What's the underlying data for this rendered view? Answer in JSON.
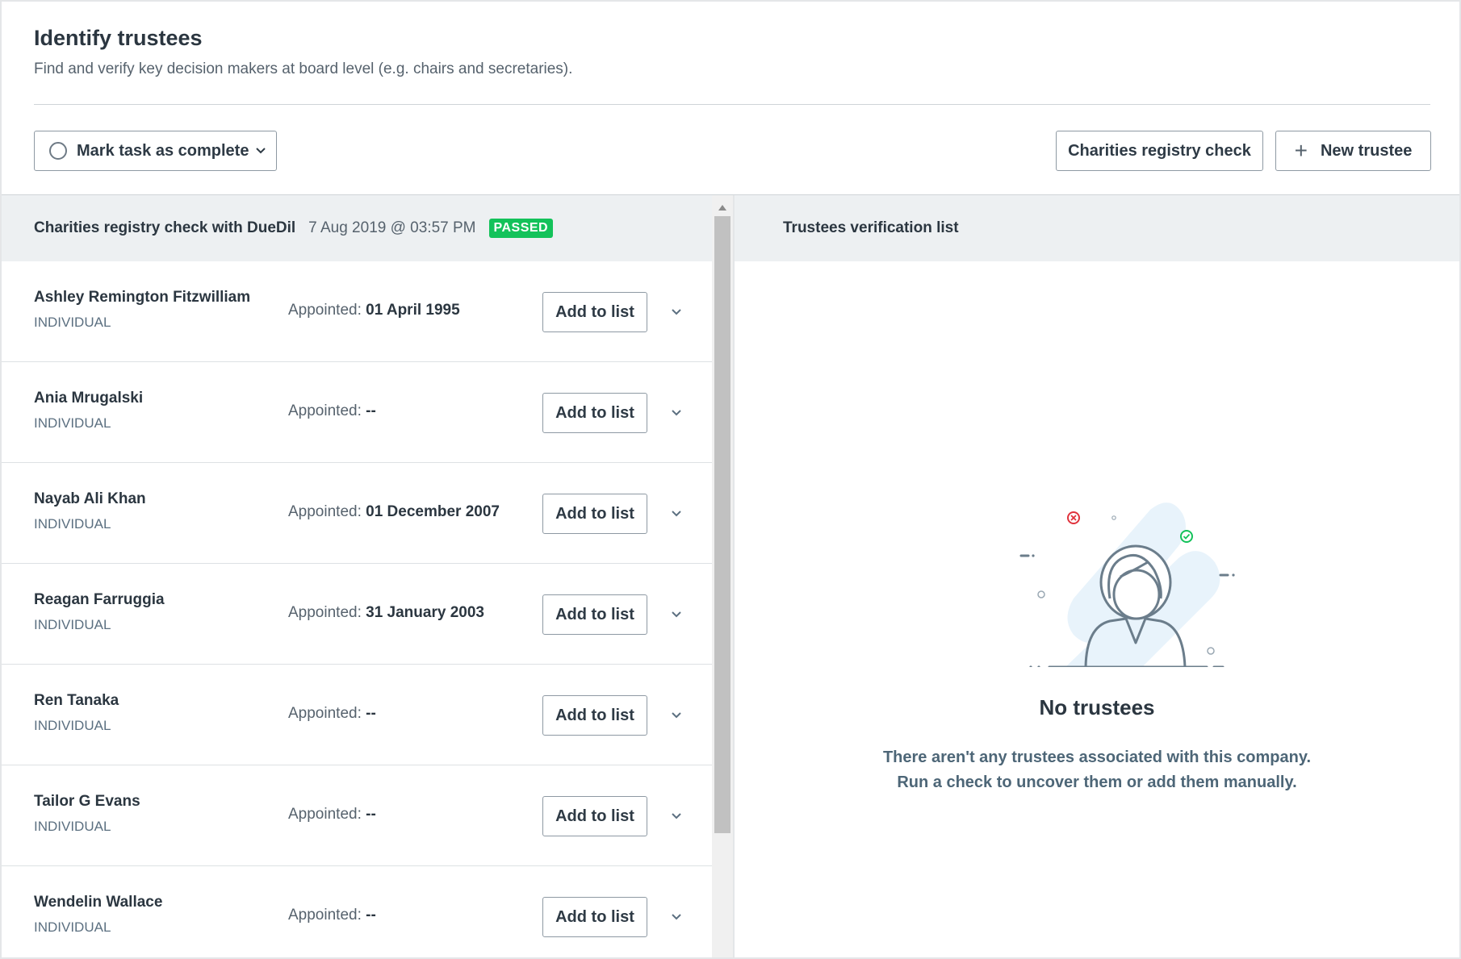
{
  "header": {
    "title": "Identify trustees",
    "subtitle": "Find and verify key decision makers at board level (e.g. chairs and secretaries)."
  },
  "toolbar": {
    "mark_complete_label": "Mark task as complete",
    "registry_check_label": "Charities registry check",
    "new_trustee_label": "New trustee"
  },
  "check": {
    "source": "Charities registry check with DueDil",
    "timestamp": "7 Aug 2019 @ 03:57 PM",
    "status": "PASSED"
  },
  "appointed_label": "Appointed: ",
  "add_label": "Add to list",
  "trustees": [
    {
      "name": "Ashley Remington Fitzwilliam",
      "type": "INDIVIDUAL",
      "appointed": "01 April 1995"
    },
    {
      "name": "Ania Mrugalski",
      "type": "INDIVIDUAL",
      "appointed": "--"
    },
    {
      "name": "Nayab Ali Khan",
      "type": "INDIVIDUAL",
      "appointed": "01 December 2007"
    },
    {
      "name": "Reagan Farruggia",
      "type": "INDIVIDUAL",
      "appointed": "31 January 2003"
    },
    {
      "name": "Ren Tanaka",
      "type": "INDIVIDUAL",
      "appointed": "--"
    },
    {
      "name": "Tailor G Evans",
      "type": "INDIVIDUAL",
      "appointed": "--"
    },
    {
      "name": "Wendelin Wallace",
      "type": "INDIVIDUAL",
      "appointed": "--"
    }
  ],
  "verification": {
    "title": "Trustees verification list",
    "empty_title": "No trustees",
    "empty_line1": "There aren't any trustees associated with this company.",
    "empty_line2": "Run a check to uncover them or add them manually."
  },
  "colors": {
    "passed_badge": "#13c25a",
    "panel_header_bg": "#edf0f2",
    "illustration_bg": "#e8f3fb",
    "error_icon": "#e0323c",
    "success_icon": "#13c25a"
  },
  "icons": {
    "complete": "circle-icon",
    "dropdown": "chevron-down-icon",
    "new": "plus-icon",
    "expand": "chevron-down-icon"
  }
}
